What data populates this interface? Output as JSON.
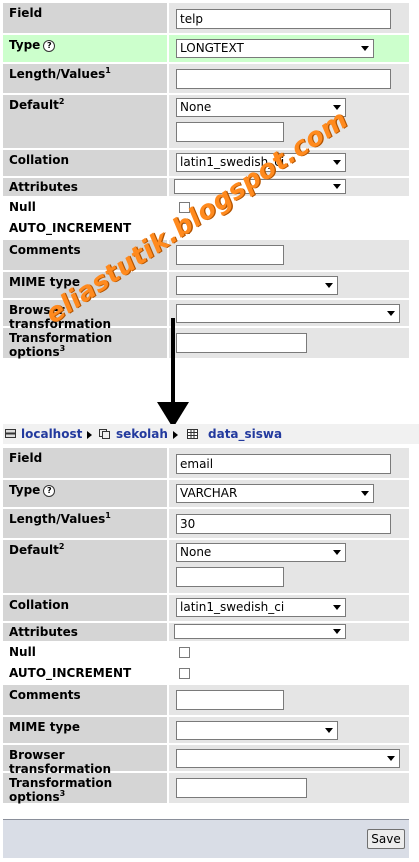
{
  "watermark": "eliastutik.blogspot.com",
  "top_form": {
    "field": {
      "label": "Field",
      "value": "telp"
    },
    "type": {
      "label": "Type",
      "value": "LONGTEXT"
    },
    "length": {
      "label": "Length/Values",
      "sup": "1",
      "value": ""
    },
    "default": {
      "label": "Default",
      "sup": "2",
      "value": "None",
      "text": ""
    },
    "collation": {
      "label": "Collation",
      "value": "latin1_swedish_ci"
    },
    "attributes": {
      "label": "Attributes",
      "value": ""
    },
    "null": {
      "label": "Null"
    },
    "auto_increment": {
      "label": "AUTO_INCREMENT"
    },
    "comments": {
      "label": "Comments",
      "value": ""
    },
    "mime": {
      "label": "MIME type",
      "value": ""
    },
    "browser": {
      "label": "Browser transformation",
      "value": ""
    },
    "transform": {
      "label": "Transformation options",
      "sup": "3",
      "value": ""
    }
  },
  "breadcrumb": {
    "server": "localhost",
    "db": "sekolah",
    "table": "data_siswa"
  },
  "bottom_form": {
    "field": {
      "label": "Field",
      "value": "email"
    },
    "type": {
      "label": "Type",
      "value": "VARCHAR"
    },
    "length": {
      "label": "Length/Values",
      "sup": "1",
      "value": "30"
    },
    "default": {
      "label": "Default",
      "sup": "2",
      "value": "None",
      "text": ""
    },
    "collation": {
      "label": "Collation",
      "value": "latin1_swedish_ci"
    },
    "attributes": {
      "label": "Attributes",
      "value": ""
    },
    "null": {
      "label": "Null"
    },
    "auto_increment": {
      "label": "AUTO_INCREMENT"
    },
    "comments": {
      "label": "Comments",
      "value": ""
    },
    "mime": {
      "label": "MIME type",
      "value": ""
    },
    "browser": {
      "label": "Browser transformation",
      "value": ""
    },
    "transform": {
      "label": "Transformation options",
      "sup": "3",
      "value": ""
    }
  },
  "save_label": "Save"
}
